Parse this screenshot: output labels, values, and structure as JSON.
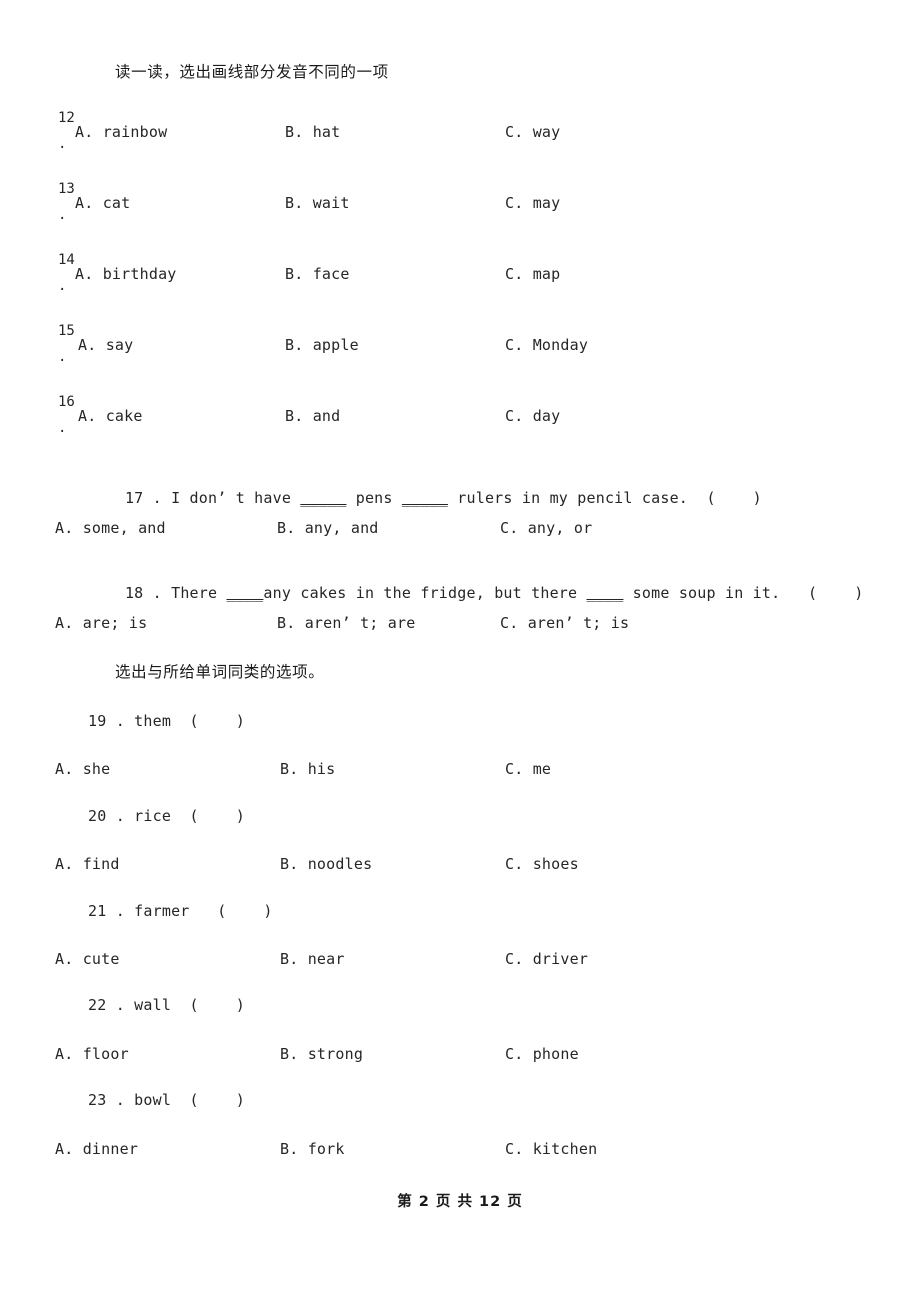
{
  "document": {
    "section_instruction_1": "读一读，选出画线部分发音不同的一项",
    "section_instruction_2": "选出与所给单词同类的选项。",
    "footer": "第 2 页 共 12 页"
  },
  "pronunciation_questions": [
    {
      "number": "12",
      "dot": ".",
      "option_a": "A. rainbow",
      "option_b": "B. hat",
      "option_c": "C. way"
    },
    {
      "number": "13",
      "dot": ".",
      "option_a": "A. cat",
      "option_b": "B. wait",
      "option_c": "C. may"
    },
    {
      "number": "14",
      "dot": ".",
      "option_a": "A. birthday",
      "option_b": "B. face",
      "option_c": "C. map"
    },
    {
      "number": "15",
      "dot": ".",
      "option_a": "A. say",
      "option_b": "B. apple",
      "option_c": "C. Monday"
    },
    {
      "number": "16",
      "dot": ".",
      "option_a": "A. cake",
      "option_b": "B. and",
      "option_c": "C. day"
    }
  ],
  "grammar_questions": [
    {
      "stem_pre": "17 . I don’ t have ",
      "stem_blank1": "_____",
      "stem_mid": " pens ",
      "stem_blank2": "_____",
      "stem_post": " rulers in my pencil case.  (    )",
      "option_a": "A. some, and",
      "option_b": "B. any, and",
      "option_c": "C. any, or"
    },
    {
      "stem_pre": "18 . There ",
      "stem_blank1": "____",
      "stem_mid": "any cakes in the fridge, but there ",
      "stem_blank2": "____",
      "stem_post": " some soup in it.   (    )",
      "option_a": "A. are; is",
      "option_b": "B. aren’ t; are",
      "option_c": "C. aren’ t; is"
    }
  ],
  "category_questions": [
    {
      "stem": "19 . them  (    )",
      "option_a": "A. she",
      "option_b": "B. his",
      "option_c": "C. me"
    },
    {
      "stem": "20 . rice  (    )",
      "option_a": "A. find",
      "option_b": "B. noodles",
      "option_c": "C. shoes"
    },
    {
      "stem": "21 . farmer   (    )",
      "option_a": "A. cute",
      "option_b": "B. near",
      "option_c": "C. driver"
    },
    {
      "stem": "22 . wall  (    )",
      "option_a": "A. floor",
      "option_b": "B. strong",
      "option_c": "C. phone"
    },
    {
      "stem": "23 . bowl  (    )",
      "option_a": "A. dinner",
      "option_b": "B. fork",
      "option_c": "C. kitchen"
    }
  ]
}
